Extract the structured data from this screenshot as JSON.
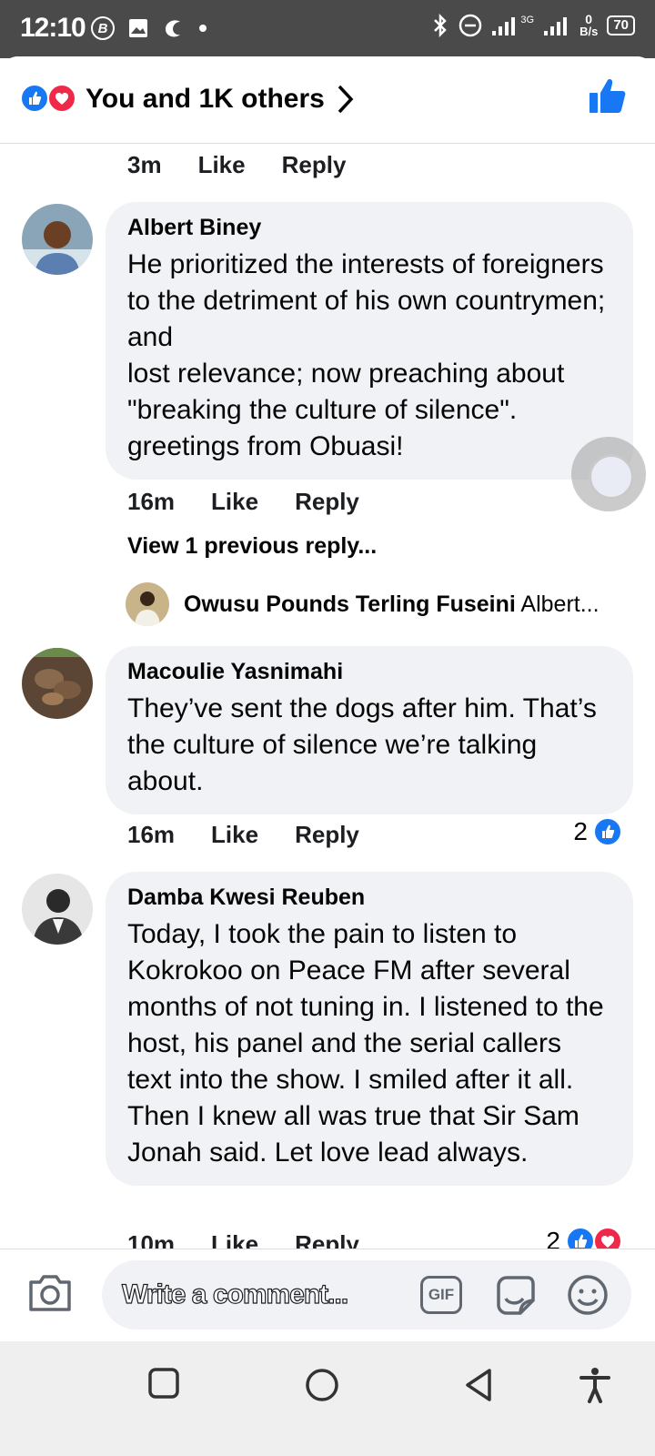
{
  "status_bar": {
    "time": "12:10",
    "left_badge": "B",
    "network_label": "3G",
    "data_rate_value": "0",
    "data_rate_unit": "B/s",
    "battery": "70"
  },
  "header": {
    "reactions_summary": "You and 1K others"
  },
  "comments": [
    {
      "meta_time": "3m",
      "like_label": "Like",
      "reply_label": "Reply"
    },
    {
      "author": "Albert Biney",
      "text": "He prioritized the interests of foreigners to the detriment of his own countrymen; and\n lost relevance; now preaching about \"breaking the culture of silence\". greetings from Obuasi!",
      "meta_time": "16m",
      "like_label": "Like",
      "reply_label": "Reply",
      "view_previous": "View 1 previous reply...",
      "reply_preview": {
        "author": "Owusu Pounds Terling Fuseini",
        "snippet": "Albert..."
      }
    },
    {
      "author": "Macoulie Yasnimahi",
      "text": "They’ve sent the dogs after him. That’s the culture of silence we’re talking about.",
      "meta_time": "16m",
      "like_label": "Like",
      "reply_label": "Reply",
      "reaction_count": "2"
    },
    {
      "author": "Damba Kwesi Reuben",
      "text": "Today, I took the pain to listen to Kokrokoo on Peace FM after several months of not tuning in. I listened to the host, his panel and the serial callers text into the show. I smiled after it all. Then I knew all was true that Sir Sam Jonah said. Let love lead always.",
      "meta_time": "10m",
      "like_label": "Like",
      "reply_label": "Reply",
      "reaction_count": "2"
    }
  ],
  "composer": {
    "placeholder": "Write a comment...",
    "gif_label": "GIF"
  },
  "colors": {
    "like_blue": "#1877f2",
    "love_red": "#f0284a",
    "bubble_bg": "#f0f2f5",
    "status_bar_bg": "#4a4a4a"
  },
  "icons": [
    "bluetooth-icon",
    "do-not-disturb-icon",
    "signal-icon",
    "camera-icon",
    "gif-icon",
    "sticker-icon",
    "emoji-icon",
    "square-nav-icon",
    "circle-nav-icon",
    "back-nav-icon",
    "accessibility-icon"
  ]
}
